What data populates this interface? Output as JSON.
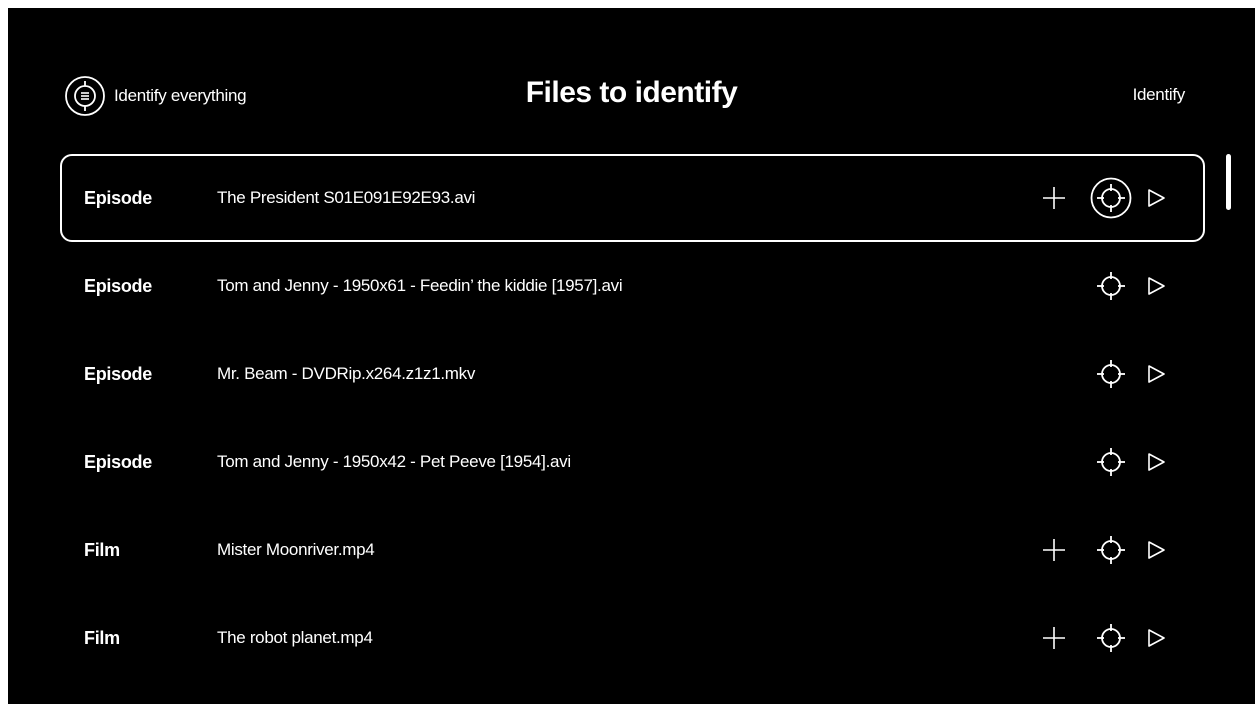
{
  "header": {
    "identify_all_label": "Identify everything",
    "identify_all_icon": "target-list-icon",
    "title": "Files to identify",
    "identify_label": "Identify"
  },
  "rows": [
    {
      "type": "Episode",
      "filename": "The President S01E091E92E93.avi",
      "has_add": true,
      "selected": true
    },
    {
      "type": "Episode",
      "filename": "Tom and Jenny - 1950x61 - Feedin’ the kiddie [1957].avi",
      "has_add": false,
      "selected": false
    },
    {
      "type": "Episode",
      "filename": "Mr. Beam - DVDRip.x264.z1z1.mkv",
      "has_add": false,
      "selected": false
    },
    {
      "type": "Episode",
      "filename": "Tom and Jenny - 1950x42 - Pet Peeve [1954].avi",
      "has_add": false,
      "selected": false
    },
    {
      "type": "Film",
      "filename": "Mister Moonriver.mp4",
      "has_add": true,
      "selected": false
    },
    {
      "type": "Film",
      "filename": "The robot planet.mp4",
      "has_add": true,
      "selected": false
    }
  ],
  "icons": {
    "add": "plus-icon",
    "identify": "crosshair-icon",
    "play": "play-icon"
  },
  "colors": {
    "background": "#000000",
    "foreground": "#ffffff"
  }
}
